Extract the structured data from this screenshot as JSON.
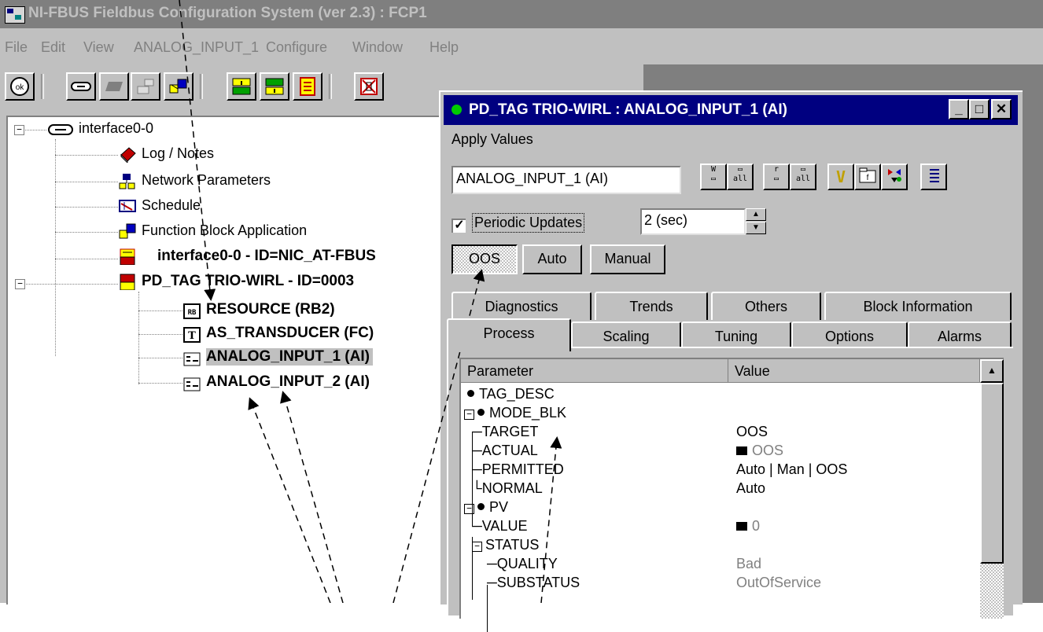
{
  "main_window": {
    "title": "NI-FBUS Fieldbus Configuration System (ver 2.3) : FCP1",
    "menu": [
      "File",
      "Edit",
      "View",
      "ANALOG_INPUT_1",
      "Configure",
      "Window",
      "Help"
    ]
  },
  "tree": {
    "root_label": "interface0-0",
    "items": [
      "Log / Notes",
      "Network Parameters",
      "Schedule",
      "Function Block Application",
      "interface0-0 - ID=NIC_AT-FBUS",
      "PD_TAG TRIO-WIRL - ID=0003"
    ],
    "blocks": [
      "RESOURCE (RB2)",
      "AS_TRANSDUCER (FC)",
      "ANALOG_INPUT_1 (AI)",
      "ANALOG_INPUT_2 (AI)"
    ]
  },
  "block_window": {
    "title": "PD_TAG TRIO-WIRL : ANALOG_INPUT_1 (AI)",
    "menu": "Apply Values",
    "block_select": "ANALOG_INPUT_1 (AI)",
    "periodic_label": "Periodic Updates",
    "periodic_checked": true,
    "interval": "2 (sec)",
    "modes": [
      "OOS",
      "Auto",
      "Manual"
    ],
    "tabs_row1": [
      "Diagnostics",
      "Trends",
      "Others",
      "Block Information"
    ],
    "tabs_row2": [
      "Process",
      "Scaling",
      "Tuning",
      "Options",
      "Alarms"
    ],
    "grid_headers": [
      "Parameter",
      "Value"
    ],
    "params": [
      {
        "name": "TAG_DESC",
        "value": ""
      },
      {
        "name": "MODE_BLK",
        "value": ""
      },
      {
        "name": "TARGET",
        "value": "OOS"
      },
      {
        "name": "ACTUAL",
        "value": "OOS"
      },
      {
        "name": "PERMITTED",
        "value": "Auto | Man | OOS"
      },
      {
        "name": "NORMAL",
        "value": "Auto"
      },
      {
        "name": "PV",
        "value": ""
      },
      {
        "name": "VALUE",
        "value": "0"
      },
      {
        "name": "STATUS",
        "value": ""
      },
      {
        "name": "QUALITY",
        "value": "Bad"
      },
      {
        "name": "SUBSTATUS",
        "value": "OutOfService"
      }
    ]
  }
}
